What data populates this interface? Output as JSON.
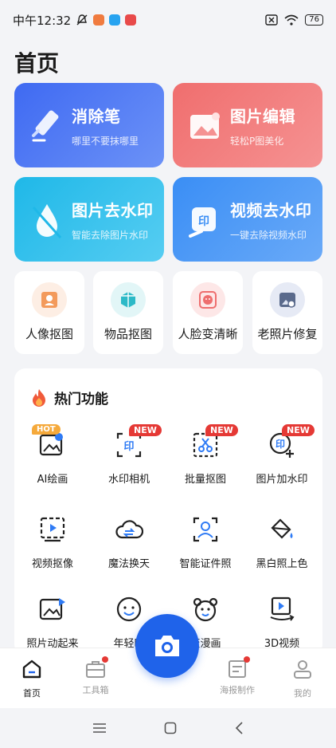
{
  "status": {
    "time": "中午12:32",
    "battery": "76"
  },
  "page_title": "首页",
  "big_cards": [
    {
      "title": "消除笔",
      "subtitle": "哪里不要抹哪里",
      "icon": "eraser-pen-icon"
    },
    {
      "title": "图片编辑",
      "subtitle": "轻松P图美化",
      "icon": "image-edit-icon"
    },
    {
      "title": "图片去水印",
      "subtitle": "智能去除图片水印",
      "icon": "water-drop-remove-icon"
    },
    {
      "title": "视频去水印",
      "subtitle": "一键去除视频水印",
      "icon": "video-watermark-icon"
    }
  ],
  "small_cards": [
    {
      "label": "人像抠图",
      "icon": "portrait-cutout-icon"
    },
    {
      "label": "物品抠图",
      "icon": "object-cutout-icon"
    },
    {
      "label": "人脸变清晰",
      "icon": "face-enhance-icon"
    },
    {
      "label": "老照片修复",
      "icon": "old-photo-repair-icon"
    }
  ],
  "hot_section": {
    "title": "热门功能"
  },
  "features": [
    {
      "label": "AI绘画",
      "badge": "HOT"
    },
    {
      "label": "水印相机",
      "badge": "NEW"
    },
    {
      "label": "批量抠图",
      "badge": "NEW"
    },
    {
      "label": "图片加水印",
      "badge": "NEW"
    },
    {
      "label": "视频抠像",
      "badge": ""
    },
    {
      "label": "魔法换天",
      "badge": ""
    },
    {
      "label": "智能证件照",
      "badge": ""
    },
    {
      "label": "黑白照上色",
      "badge": ""
    },
    {
      "label": "照片动起来",
      "badge": ""
    },
    {
      "label": "年轻时",
      "badge": ""
    },
    {
      "label": "变漫画",
      "badge": ""
    },
    {
      "label": "3D视频",
      "badge": ""
    }
  ],
  "tabs": [
    {
      "label": "首页",
      "active": true
    },
    {
      "label": "工具箱",
      "active": false
    },
    {
      "label": "海报制作",
      "active": false
    },
    {
      "label": "我的",
      "active": false
    }
  ],
  "colors": {
    "accent": "#1f63ea",
    "badge_red": "#e53935",
    "hot_orange": "#f5a93b"
  }
}
